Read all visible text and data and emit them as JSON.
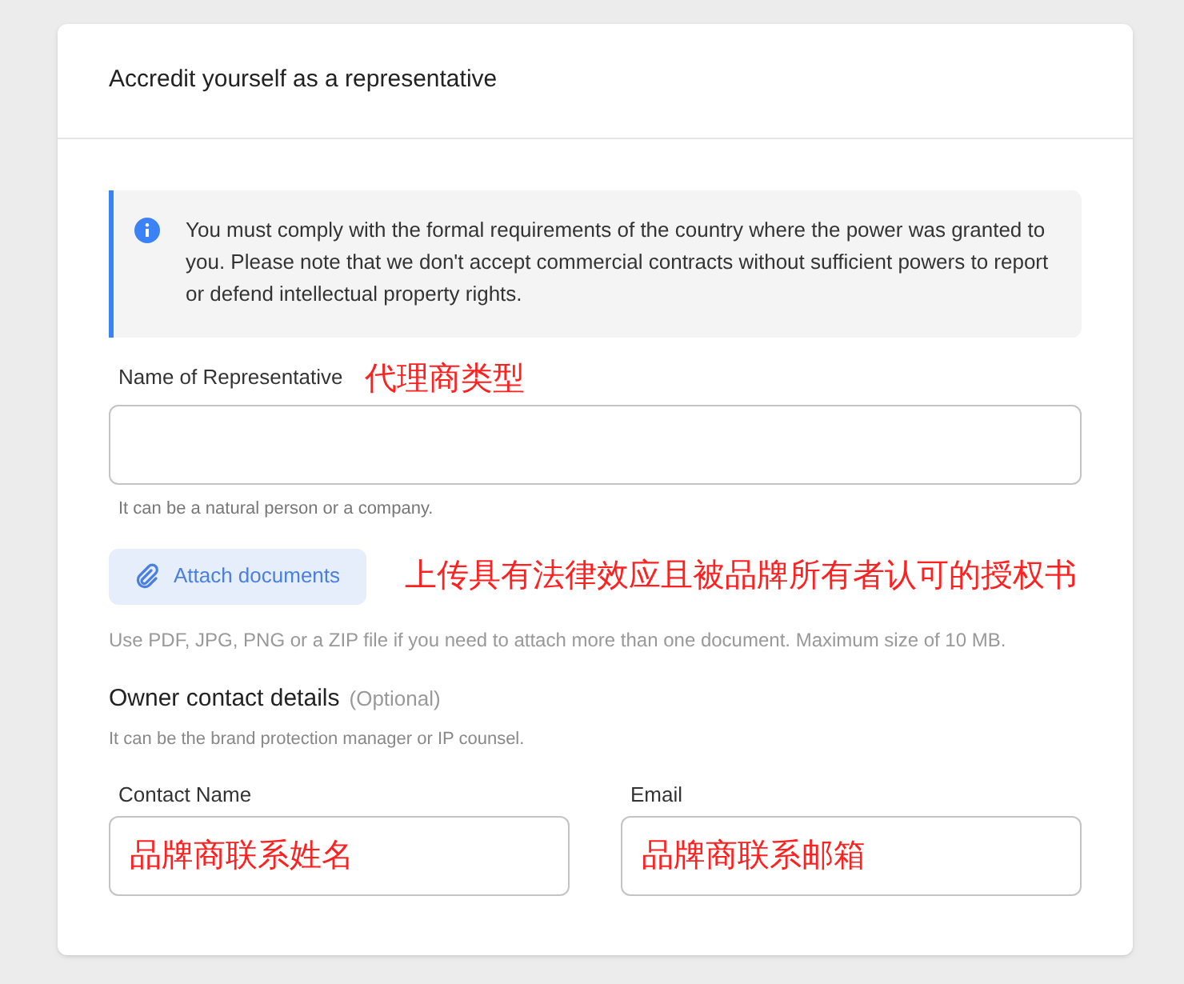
{
  "card": {
    "title": "Accredit yourself as a representative"
  },
  "alert": {
    "text": "You must comply with the formal requirements of the country where the power was granted to you. Please note that we don't accept commercial contracts without sufficient powers to report or defend intellectual property rights."
  },
  "representative": {
    "label": "Name of Representative",
    "annotation": "代理商类型",
    "hint": "It can be a natural person or a company."
  },
  "attach": {
    "label": "Attach documents",
    "annotation": "上传具有法律效应且被品牌所有者认可的授权书",
    "hint": "Use PDF, JPG, PNG or a ZIP file if you need to attach more than one document. Maximum size of 10 MB."
  },
  "owner": {
    "title": "Owner contact details",
    "optional": "(Optional)",
    "hint": "It can be the brand protection manager or IP counsel.",
    "fields": [
      {
        "label": "Contact Name",
        "annotation": "品牌商联系姓名"
      },
      {
        "label": "Email",
        "annotation": "品牌商联系邮箱"
      }
    ]
  }
}
